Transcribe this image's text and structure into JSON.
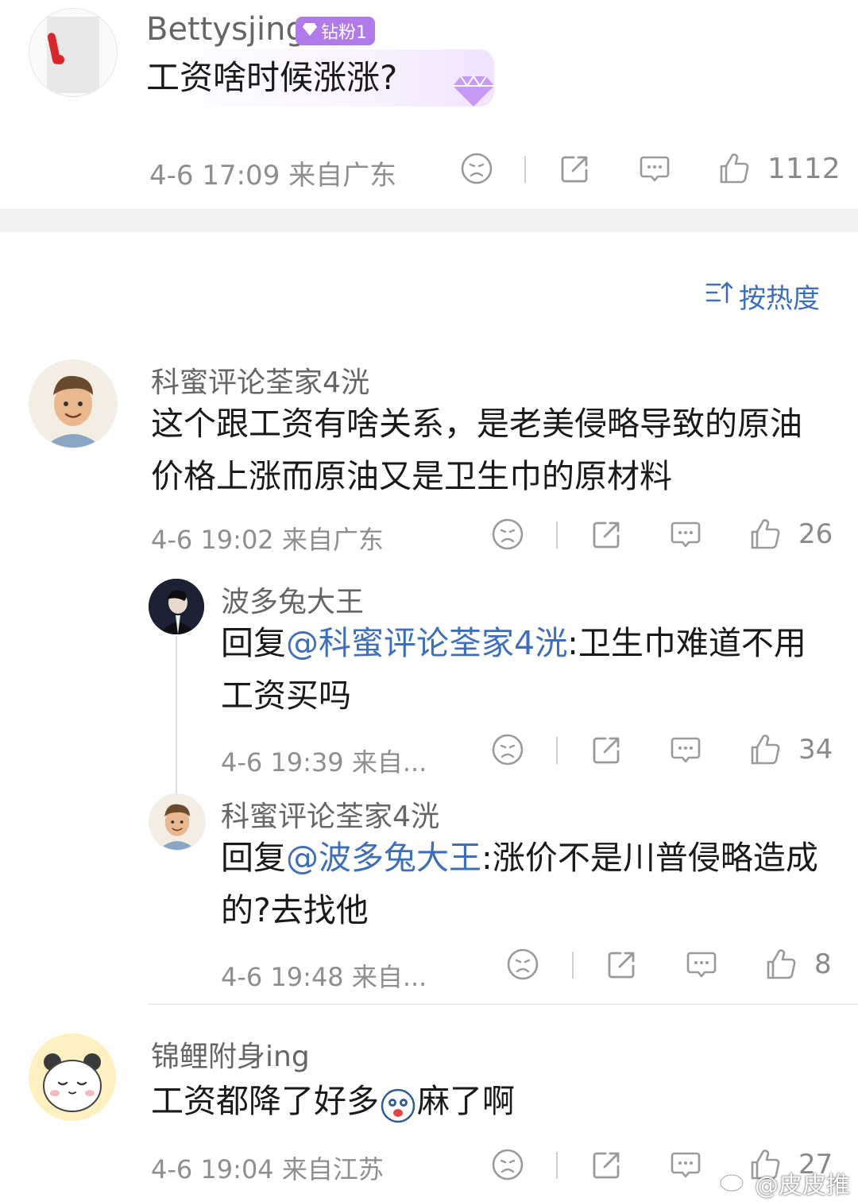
{
  "top_comment": {
    "username": "Bettysjing",
    "badge": "钻粉1",
    "text": "工资啥时候涨涨?",
    "time_location": "4-6 17:09 来自广东",
    "likes": "1112"
  },
  "sort": {
    "label": "按热度"
  },
  "comments": [
    {
      "username": "科蜜评论荃家4洸",
      "text": "这个跟工资有啥关系，是老美侵略导致的原油价格上涨而原油又是卫生巾的原材料",
      "time_location": "4-6 19:02 来自广东",
      "likes": "26",
      "replies": [
        {
          "username": "波多兔大王",
          "prefix": "回复",
          "mention": "@科蜜评论荃家4洸",
          "text": ":卫生巾难道不用工资买吗",
          "time_location": "4-6 19:39 来自...",
          "likes": "34"
        },
        {
          "username": "科蜜评论荃家4洸",
          "prefix": "回复",
          "mention": "@波多兔大王",
          "text": ":涨价不是川普侵略造成的?去找他",
          "time_location": "4-6 19:48 来自...",
          "likes": "8"
        }
      ]
    },
    {
      "username": "锦鲤附身ing",
      "text_before": "工资都降了好多",
      "text_after": "麻了啊",
      "time_location": "4-6 19:04 来自江苏",
      "likes": "27"
    }
  ],
  "watermark": "@皮皮推",
  "colors": {
    "mention": "#3e6fb8",
    "badge": "#b07ae8",
    "meta": "#8e8e8e",
    "divider": "#f2f2f2"
  },
  "icons": [
    "sad-face-icon",
    "share-icon",
    "comment-icon",
    "thumbs-up-icon",
    "sort-icon",
    "diamond-icon"
  ]
}
